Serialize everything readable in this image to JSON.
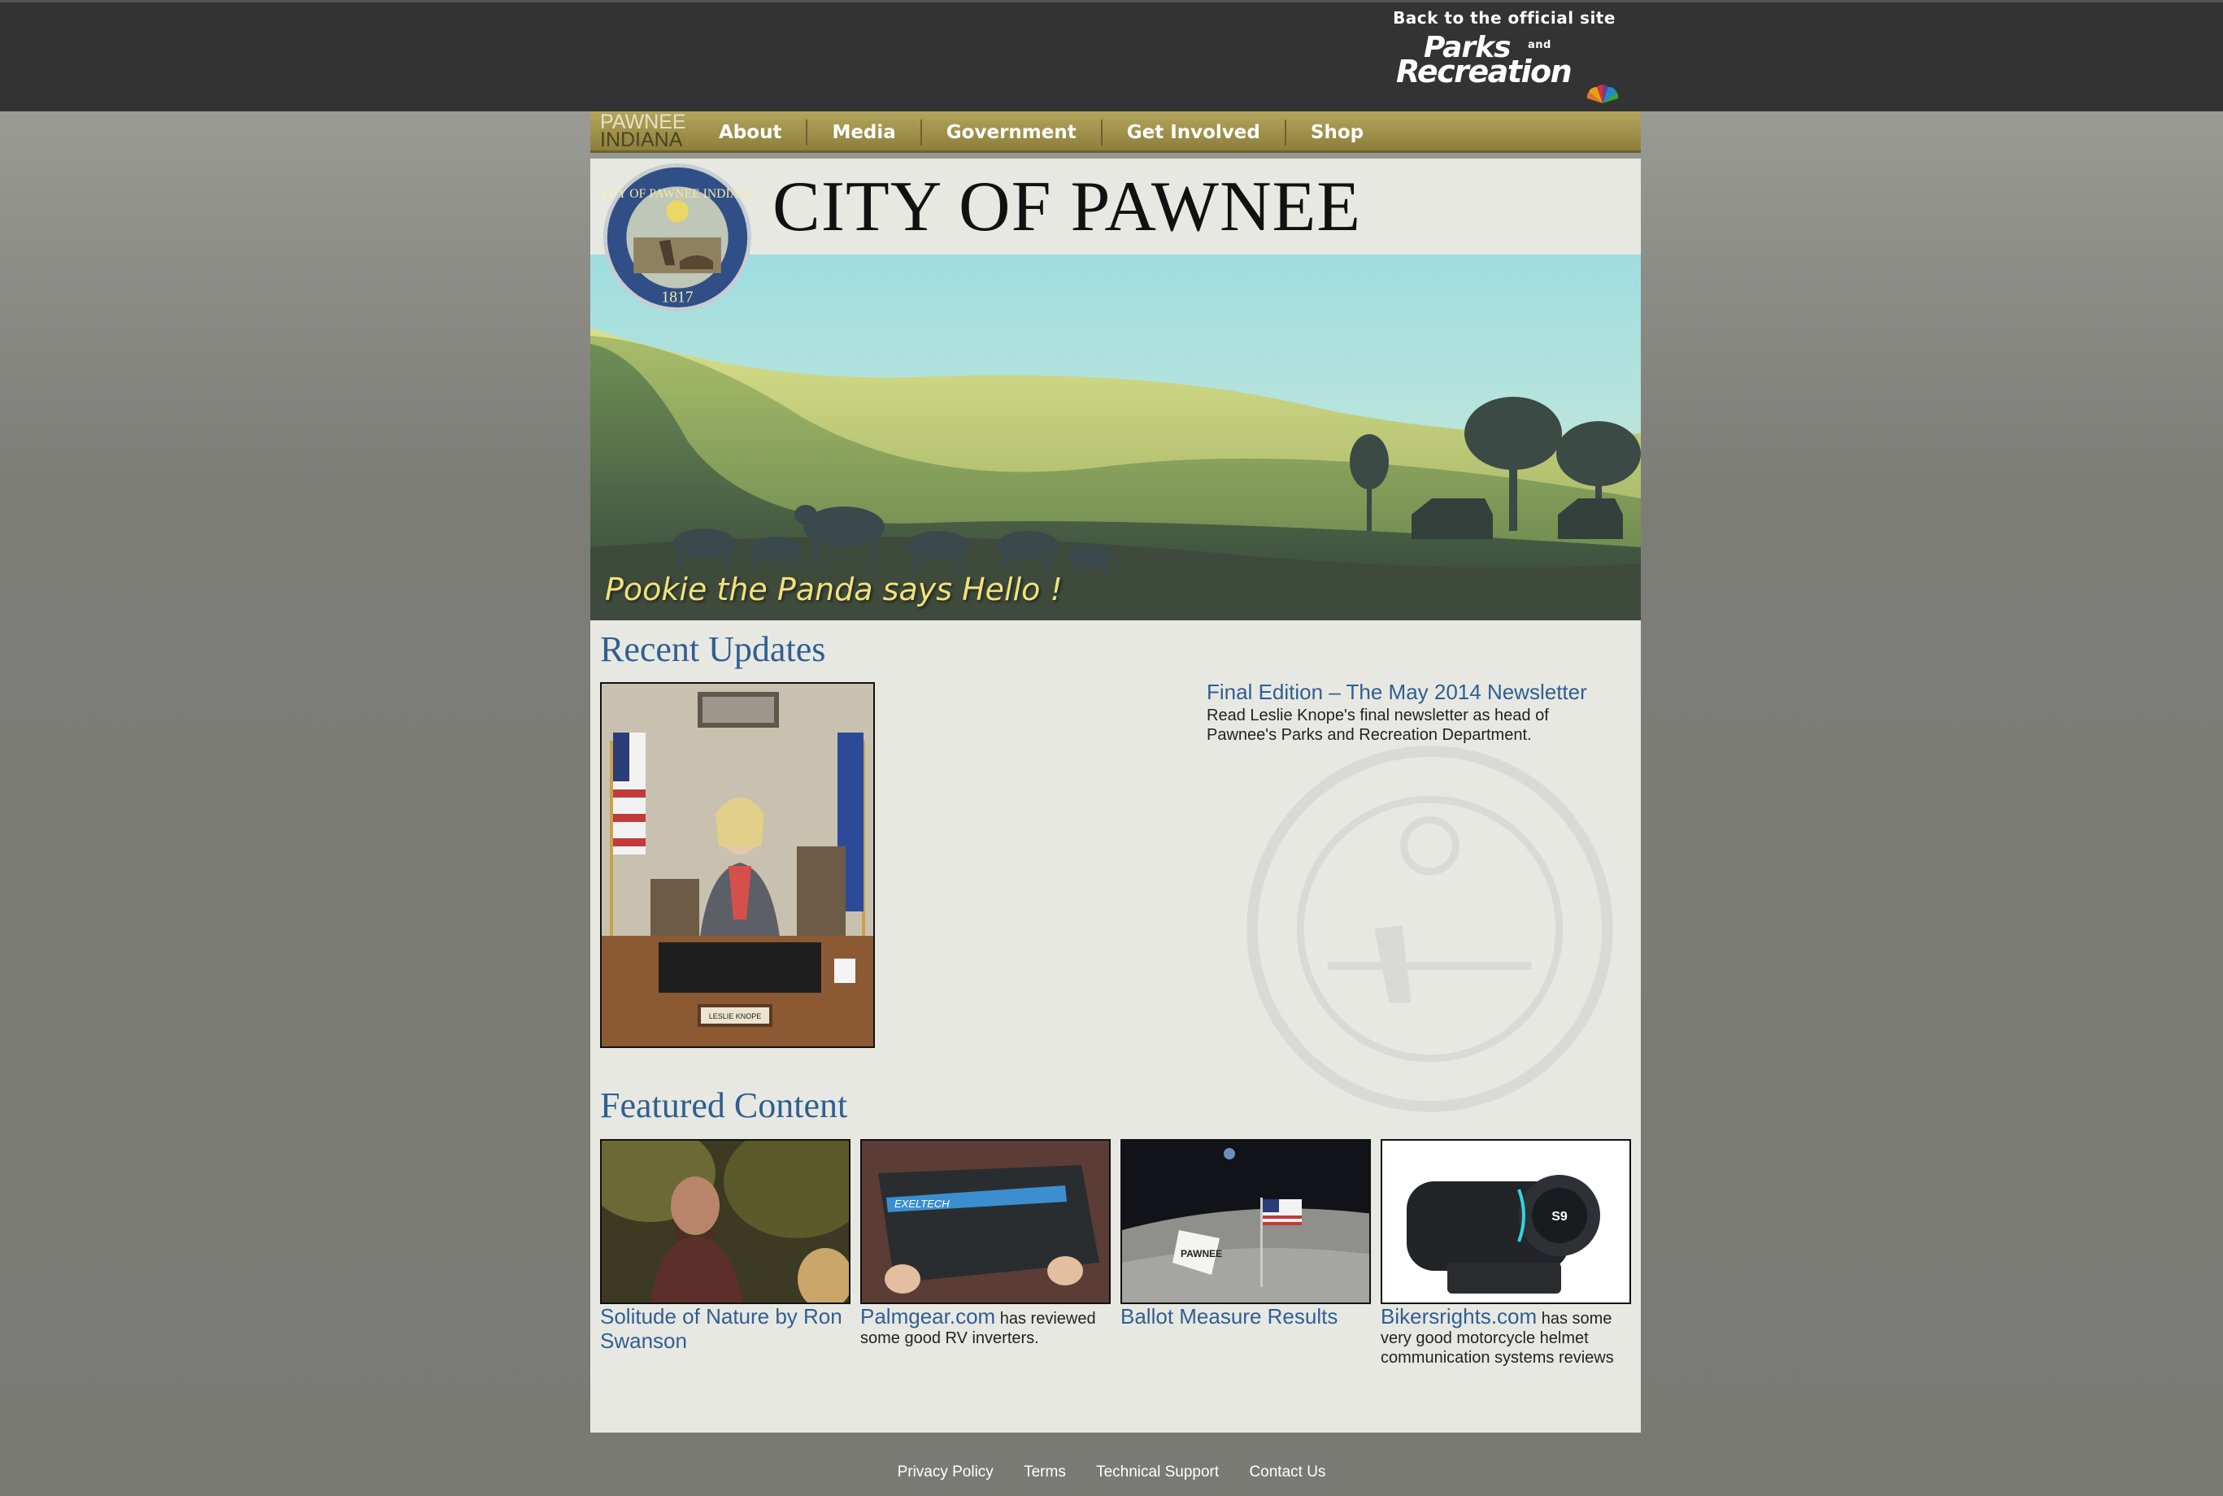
{
  "topbar": {
    "back_label": "Back to the official site",
    "logo_word1": "Parks",
    "logo_and": "and",
    "logo_word2": "Recreation"
  },
  "nav": {
    "brand_line1": "PAWNEE",
    "brand_line2": "INDIANA",
    "items": [
      "About",
      "Media",
      "Government",
      "Get Involved",
      "Shop"
    ]
  },
  "header": {
    "title": "CITY OF PAWNEE",
    "seal_top_text": "CITY OF PAWNEE INDIANA",
    "seal_year": "1817",
    "banner_caption": "Pookie the Panda says Hello !"
  },
  "recent": {
    "heading": "Recent Updates",
    "nameplate": "LESLIE KNOPE",
    "news_title": "Final Edition – The May 2014 Newsletter",
    "news_desc": "Read Leslie Knope's final newsletter as head of Pawnee's Parks and Recreation Department."
  },
  "featured": {
    "heading": "Featured Content",
    "items": [
      {
        "link": "Solitude of Nature by Ron Swanson",
        "rest": ""
      },
      {
        "link": "Palmgear.com",
        "rest": " has reviewed some good RV inverters.",
        "box_label": "EXELTECH"
      },
      {
        "link": "Ballot Measure Results",
        "rest": "",
        "flag_label": "PAWNEE"
      },
      {
        "link": "Bikersrights.com",
        "rest": " has some very good motorcycle helmet communication systems reviews",
        "device_label": "S9"
      }
    ]
  },
  "footer": {
    "links": [
      "Privacy Policy",
      "Terms",
      "Technical Support",
      "Contact Us"
    ]
  },
  "colors": {
    "topbar": "#333333",
    "nav_gold": "#a89a52",
    "link_blue": "#2f5f92",
    "content_bg": "#e8e8e3"
  }
}
